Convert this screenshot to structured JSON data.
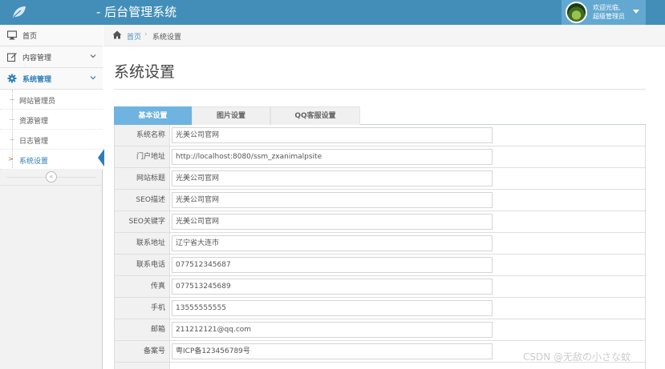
{
  "header": {
    "title": "- 后台管理系统",
    "welcome_line1": "欢迎光临,",
    "welcome_line2": "超级管理员"
  },
  "sidebar": {
    "items": [
      {
        "label": "首页",
        "icon": "desktop-icon"
      },
      {
        "label": "内容管理",
        "icon": "edit-icon"
      },
      {
        "label": "系统管理",
        "icon": "gear-icon"
      }
    ],
    "submenu": [
      {
        "label": "网站管理员"
      },
      {
        "label": "资源管理"
      },
      {
        "label": "日志管理"
      },
      {
        "label": "系统设置"
      }
    ],
    "current_marker": ">",
    "collapse_glyph": "«"
  },
  "breadcrumb": {
    "home": "首页",
    "separator": "›",
    "current": "系统设置"
  },
  "page": {
    "title": "系统设置"
  },
  "tabs": [
    {
      "label": "基本设置",
      "active": true
    },
    {
      "label": "图片设置",
      "active": false
    },
    {
      "label": "QQ客服设置",
      "active": false
    }
  ],
  "form": {
    "fields": [
      {
        "label": "系统名称",
        "value": "光美公司官网"
      },
      {
        "label": "门户地址",
        "value": "http://localhost:8080/ssm_zxanimalpsite"
      },
      {
        "label": "网站标题",
        "value": "光美公司官网"
      },
      {
        "label": "SEO描述",
        "value": "光美公司官网"
      },
      {
        "label": "SEO关键字",
        "value": "光美公司官网"
      },
      {
        "label": "联系地址",
        "value": "辽宁省大连市"
      },
      {
        "label": "联系电话",
        "value": "077512345687"
      },
      {
        "label": "传真",
        "value": "077513245689"
      },
      {
        "label": "手机",
        "value": "13555555555"
      },
      {
        "label": "邮箱",
        "value": "211212121@qq.com"
      },
      {
        "label": "备案号",
        "value": "粤ICP备123456789号"
      }
    ]
  },
  "watermark": "CSDN @无敌の小さな蚊",
  "colors": {
    "header": "#438eb9",
    "user_box": "#62a8d1",
    "active_tab": "#6fb3e0",
    "link": "#4c8fbd"
  }
}
